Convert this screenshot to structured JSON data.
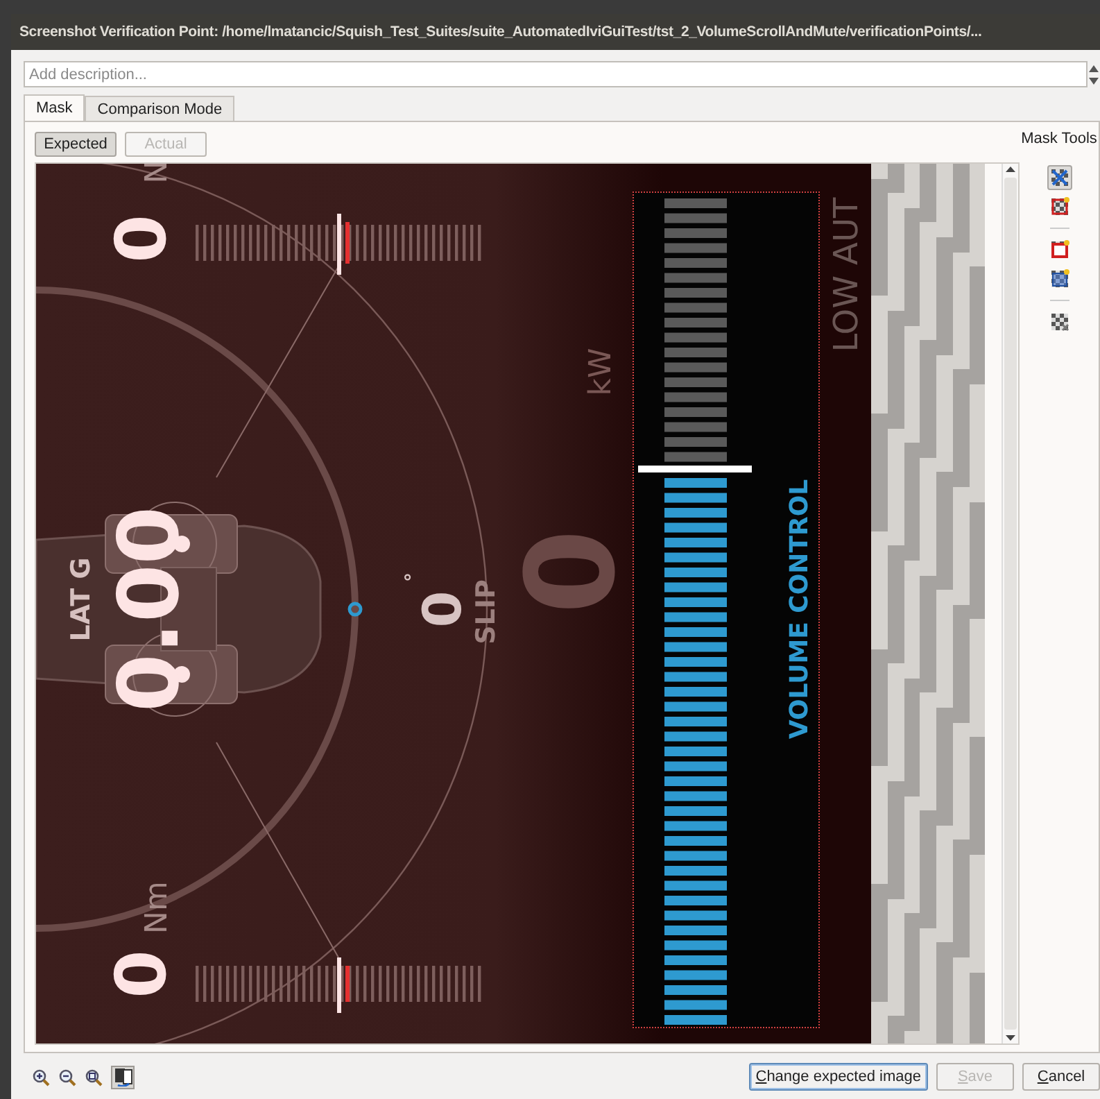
{
  "window": {
    "title": "Screenshot Verification Point: /home/lmatancic/Squish_Test_Suites/suite_AutomatedIviGuiTest/tst_2_VolumeScrollAndMute/verificationPoints/..."
  },
  "description": {
    "placeholder": "Add description..."
  },
  "tabs": [
    {
      "label": "Mask",
      "selected": true
    },
    {
      "label": "Comparison Mode",
      "selected": false
    }
  ],
  "image_buttons": [
    {
      "label": "Expected",
      "selected": true,
      "disabled": false
    },
    {
      "label": "Actual",
      "selected": false,
      "disabled": true
    }
  ],
  "mask_tools": {
    "title": "Mask Tools",
    "tools": [
      {
        "kind": "pick",
        "selected": true
      },
      {
        "kind": "region",
        "selected": false
      },
      {
        "kind": "exclude",
        "selected": false
      },
      {
        "kind": "include",
        "selected": false
      },
      {
        "kind": "clear",
        "selected": false
      }
    ]
  },
  "screenshot": {
    "top_torque": {
      "value": "0",
      "unit": "N"
    },
    "lat_g": {
      "label": "LAT G",
      "value": "0.00"
    },
    "slip": {
      "value": "0",
      "unit": "°",
      "label": "SLIP"
    },
    "power": {
      "value": "0",
      "unit": "kW"
    },
    "mode": "LOW AUT",
    "bottom_torque": {
      "value": "0",
      "unit": "Nm"
    },
    "volume": {
      "title": "VOLUME CONTROL",
      "level": 0.67
    }
  },
  "footer": {
    "view_toggle": {
      "on": true
    },
    "buttons": [
      {
        "label": "Change expected image",
        "disabled": false,
        "default": true
      },
      {
        "label": "Save",
        "disabled": true,
        "default": false
      },
      {
        "label": "Cancel",
        "disabled": false,
        "default": false
      }
    ]
  }
}
